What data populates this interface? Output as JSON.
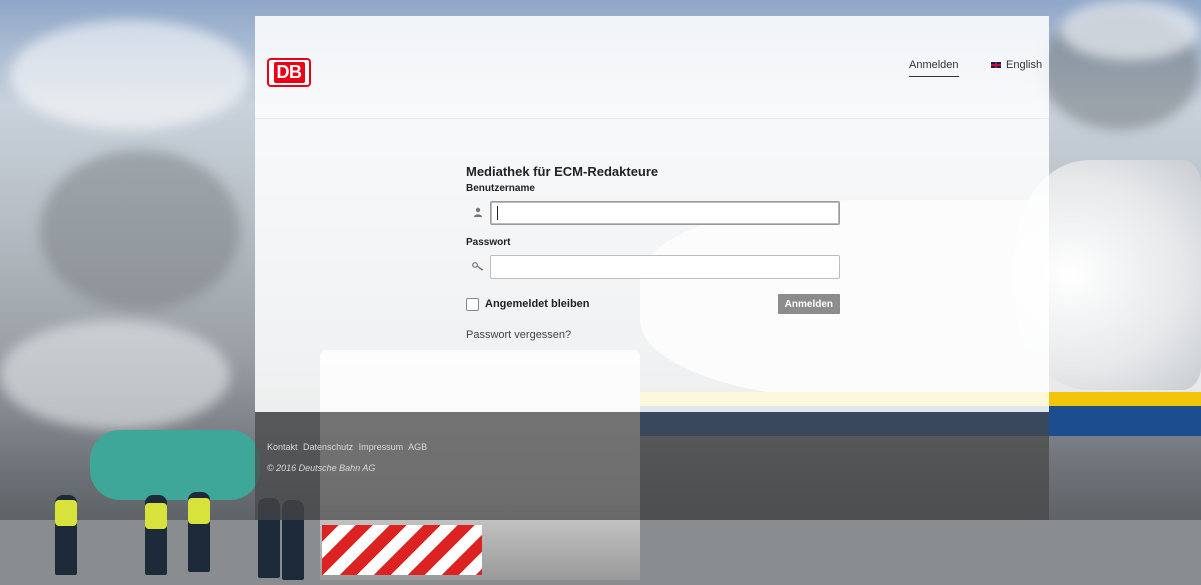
{
  "header": {
    "logo_text": "DB",
    "nav_login": "Anmelden",
    "nav_language": "English"
  },
  "form": {
    "title": "Mediathek für ECM-Redakteure",
    "username_label": "Benutzername",
    "username_value": "",
    "password_label": "Passwort",
    "password_value": "",
    "remember_label": "Angemeldet bleiben",
    "submit_label": "Anmelden",
    "forgot_label": "Passwort vergessen?"
  },
  "footer": {
    "links": [
      "Kontakt",
      "Datenschutz",
      "Impressum",
      "AGB"
    ],
    "copyright": "© 2016 Deutsche Bahn AG"
  },
  "colors": {
    "brand_red": "#ec0016",
    "button_gray": "#8c8c8c"
  },
  "icons": {
    "username": "user-icon",
    "password": "key-icon",
    "language": "uk-flag-icon"
  }
}
